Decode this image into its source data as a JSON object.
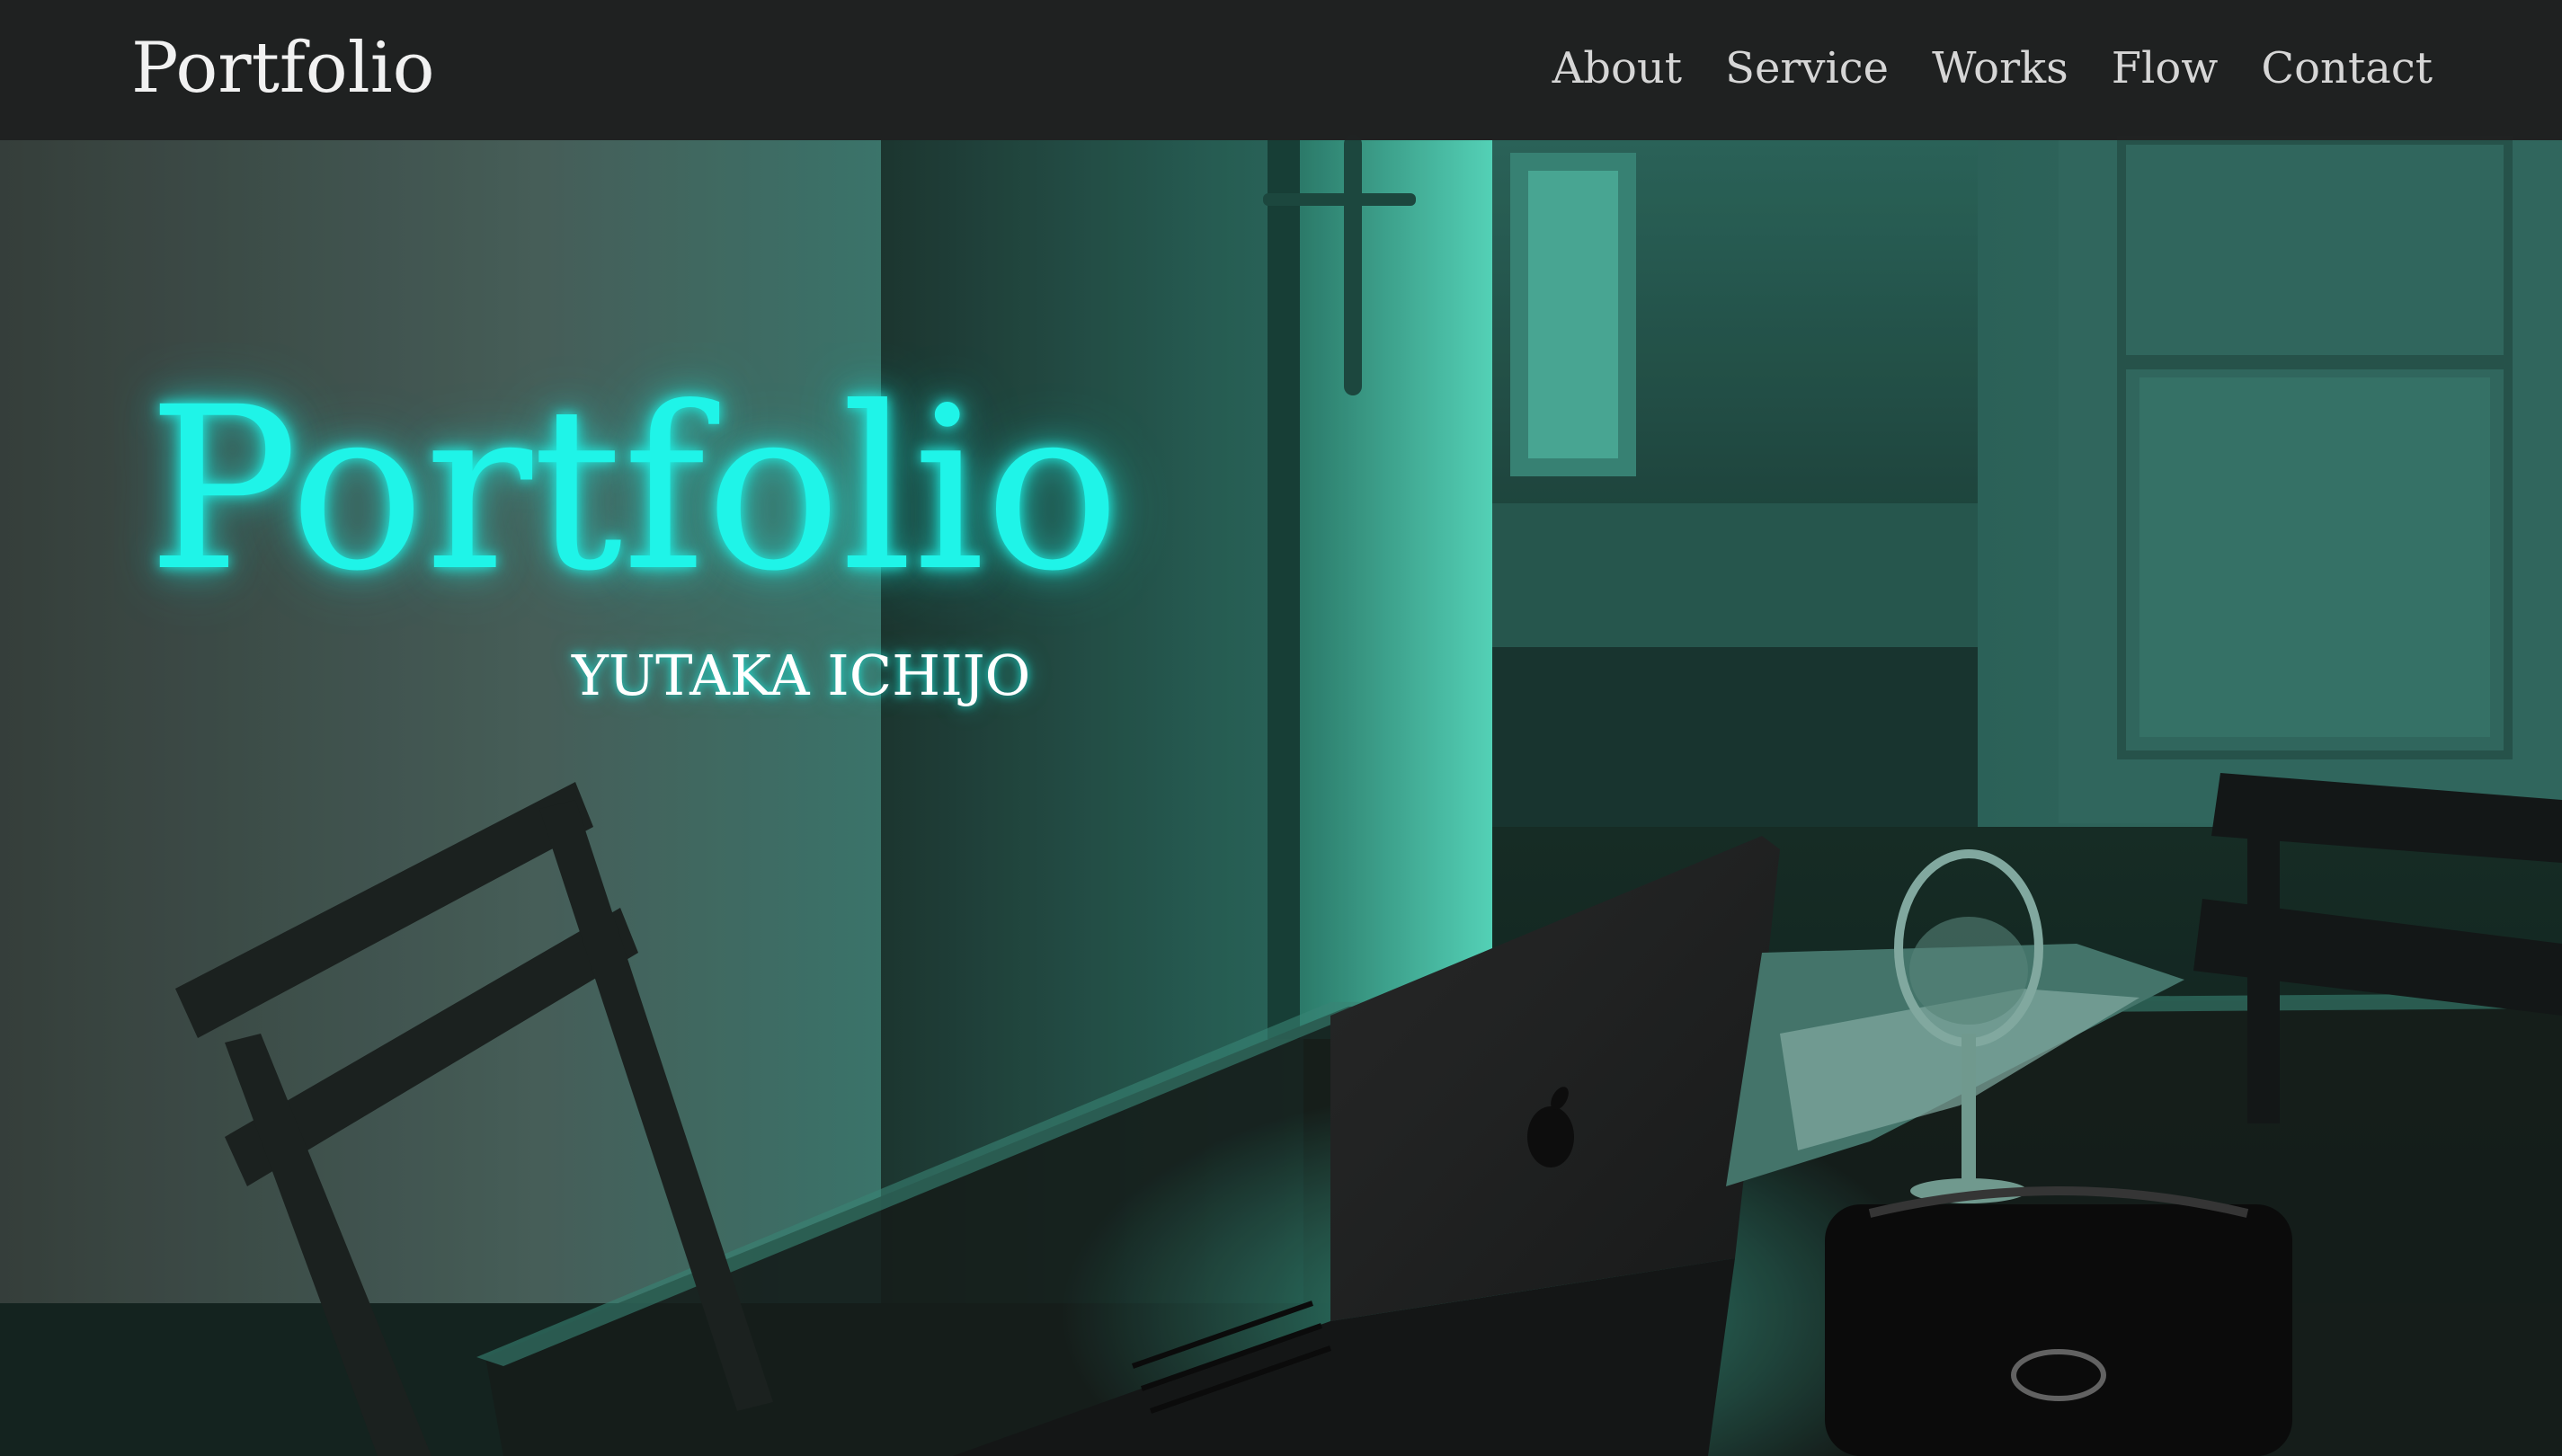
{
  "header": {
    "brand": "Portfolio",
    "nav": [
      {
        "label": "About"
      },
      {
        "label": "Service"
      },
      {
        "label": "Works"
      },
      {
        "label": "Flow"
      },
      {
        "label": "Contact"
      }
    ]
  },
  "hero": {
    "title": "Portfolio",
    "subtitle": "YUTAKA ICHIJO"
  },
  "colors": {
    "accent": "#1ff4e8",
    "nav_bg": "#202121",
    "nav_text": "#d6d6d6"
  }
}
